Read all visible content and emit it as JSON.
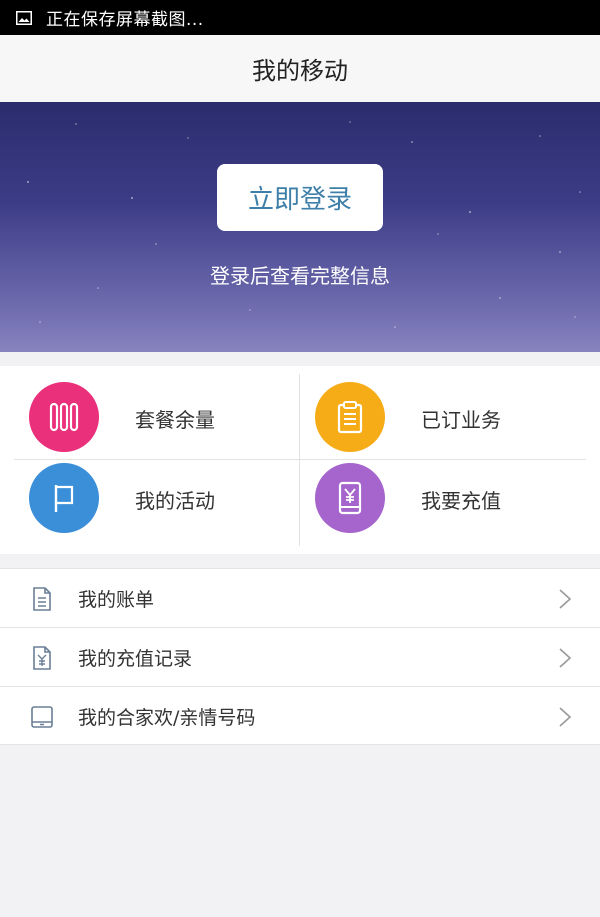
{
  "status_bar": {
    "text": "正在保存屏幕截图..."
  },
  "header": {
    "title": "我的移动"
  },
  "banner": {
    "login_button": "立即登录",
    "subtitle": "登录后查看完整信息"
  },
  "grid": {
    "items": [
      {
        "label": "套餐余量",
        "color": "#ea2f7b",
        "icon": "bars-icon"
      },
      {
        "label": "已订业务",
        "color": "#f6ac17",
        "icon": "clipboard-icon"
      },
      {
        "label": "我的活动",
        "color": "#3a8fd8",
        "icon": "flag-icon"
      },
      {
        "label": "我要充值",
        "color": "#a565cc",
        "icon": "phone-yen-icon"
      }
    ]
  },
  "menu": {
    "items": [
      {
        "label": "我的账单",
        "icon": "document-icon"
      },
      {
        "label": "我的充值记录",
        "icon": "yen-document-icon"
      },
      {
        "label": "我的合家欢/亲情号码",
        "icon": "tablet-icon"
      }
    ]
  }
}
